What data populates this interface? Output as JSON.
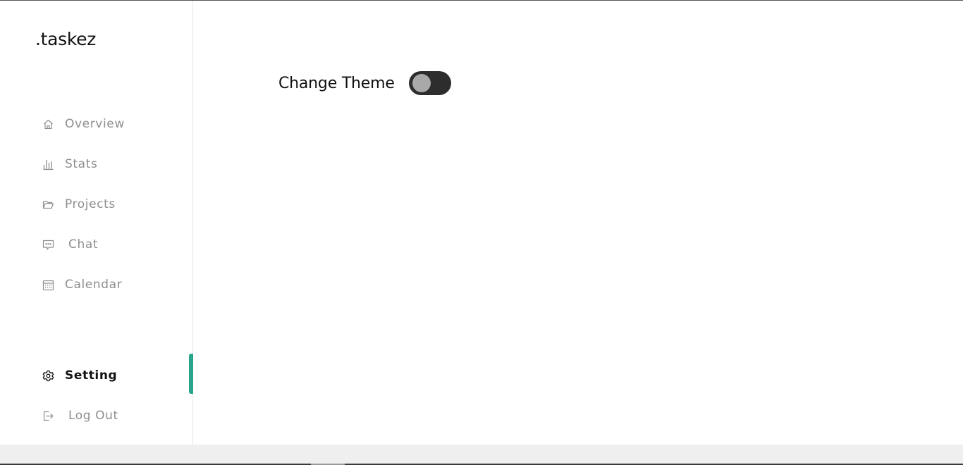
{
  "app": {
    "logo": ".taskez"
  },
  "sidebar": {
    "items": [
      {
        "label": "Overview",
        "icon": "home-icon"
      },
      {
        "label": "Stats",
        "icon": "bar-chart-icon"
      },
      {
        "label": "Projects",
        "icon": "folder-icon"
      },
      {
        "label": "Chat",
        "icon": "chat-icon"
      },
      {
        "label": "Calendar",
        "icon": "calendar-icon"
      }
    ],
    "setting": {
      "label": "Setting",
      "icon": "gear-icon",
      "active": true
    },
    "logout": {
      "label": "Log Out",
      "icon": "logout-icon"
    }
  },
  "main": {
    "theme_label": "Change Theme",
    "theme_toggle_on": false
  },
  "colors": {
    "accent": "#28a58a",
    "toggle_track": "#2d2d2d",
    "toggle_knob": "#a9a9a9",
    "nav_text": "#8e8e8e"
  }
}
